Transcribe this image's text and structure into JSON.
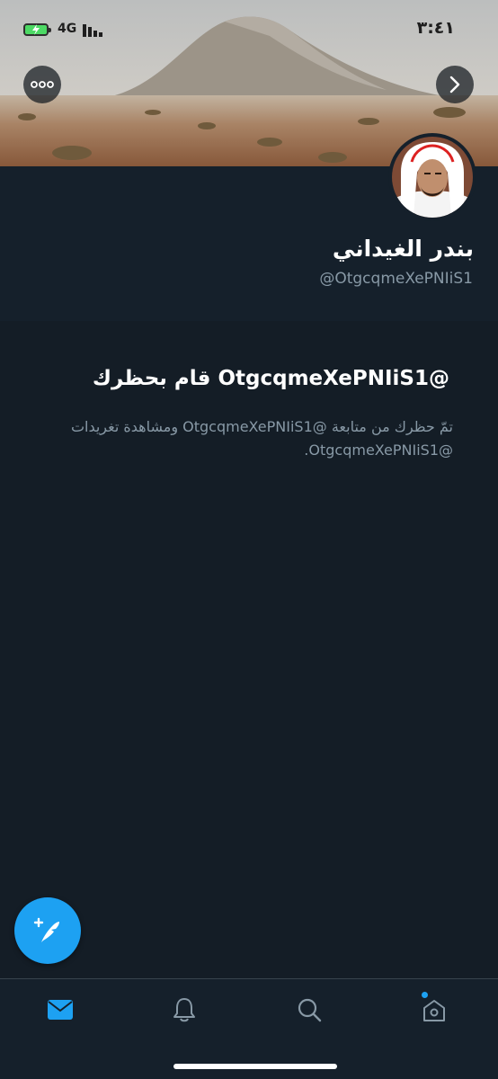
{
  "status": {
    "time": "٣:٤١",
    "network": "4G"
  },
  "profile": {
    "name": "بندر الغيداني",
    "handle": "@OtgcqmeXePNIiS1"
  },
  "blocked": {
    "title": "@OtgcqmeXePNIiS1 قام بحظرك",
    "description": "تمّ حظرك من متابعة @OtgcqmeXePNIiS1 ومشاهدة تغريدات @OtgcqmeXePNIiS1."
  },
  "icons": {
    "more": "more-icon",
    "next": "chevron-right-icon",
    "compose": "compose-tweet-icon",
    "messages": "mail-icon",
    "notifications": "bell-icon",
    "search": "search-icon",
    "home": "home-icon"
  },
  "colors": {
    "background": "#15202b",
    "accent": "#1da1f2",
    "secondary_text": "#8899a6"
  }
}
